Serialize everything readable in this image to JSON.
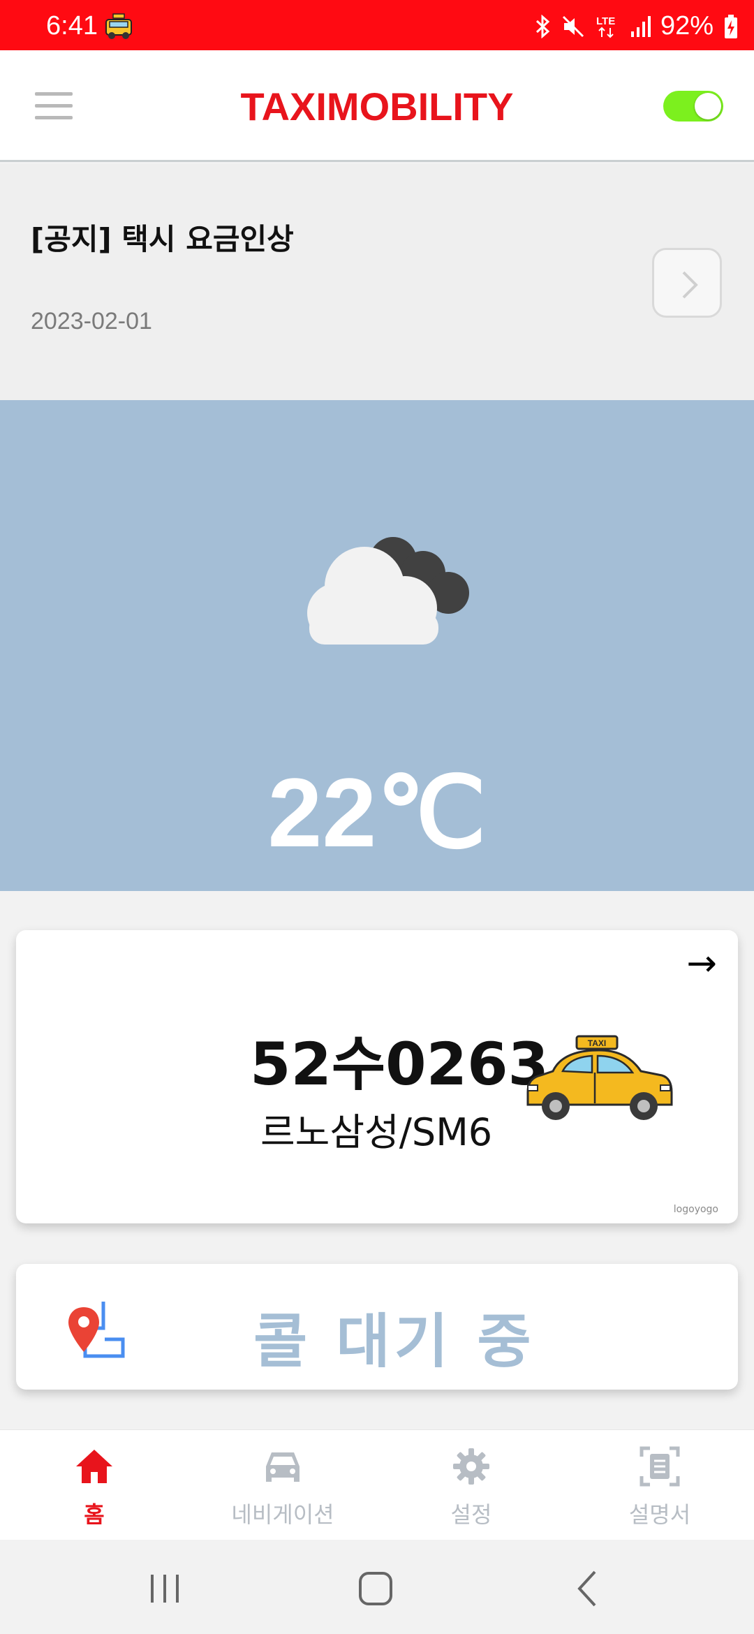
{
  "status_bar": {
    "time": "6:41",
    "battery": "92%",
    "network": "LTE"
  },
  "header": {
    "title": "TAXIMOBILITY",
    "toggle_on": true,
    "accent_color": "#e8141c",
    "toggle_color": "#7cf01e"
  },
  "notice": {
    "title": "[공지] 택시 요금인상",
    "date": "2023-02-01"
  },
  "weather": {
    "icon": "partly-cloudy-night-icon",
    "temperature": "22℃",
    "background_color": "#a4bed6"
  },
  "vehicle": {
    "plate": "52수0263",
    "model": "르노삼성/SM6",
    "image": "taxi-car-image",
    "watermark": "logoyogo",
    "arrow": "→"
  },
  "call": {
    "status": "콜 대기 중",
    "icon": "route-pin-icon",
    "status_color": "#a5bed5"
  },
  "bottom_nav": {
    "items": [
      {
        "label": "홈",
        "icon": "home-icon",
        "active": true
      },
      {
        "label": "네비게이션",
        "icon": "car-icon",
        "active": false
      },
      {
        "label": "설정",
        "icon": "gear-icon",
        "active": false
      },
      {
        "label": "설명서",
        "icon": "document-scan-icon",
        "active": false
      }
    ]
  }
}
